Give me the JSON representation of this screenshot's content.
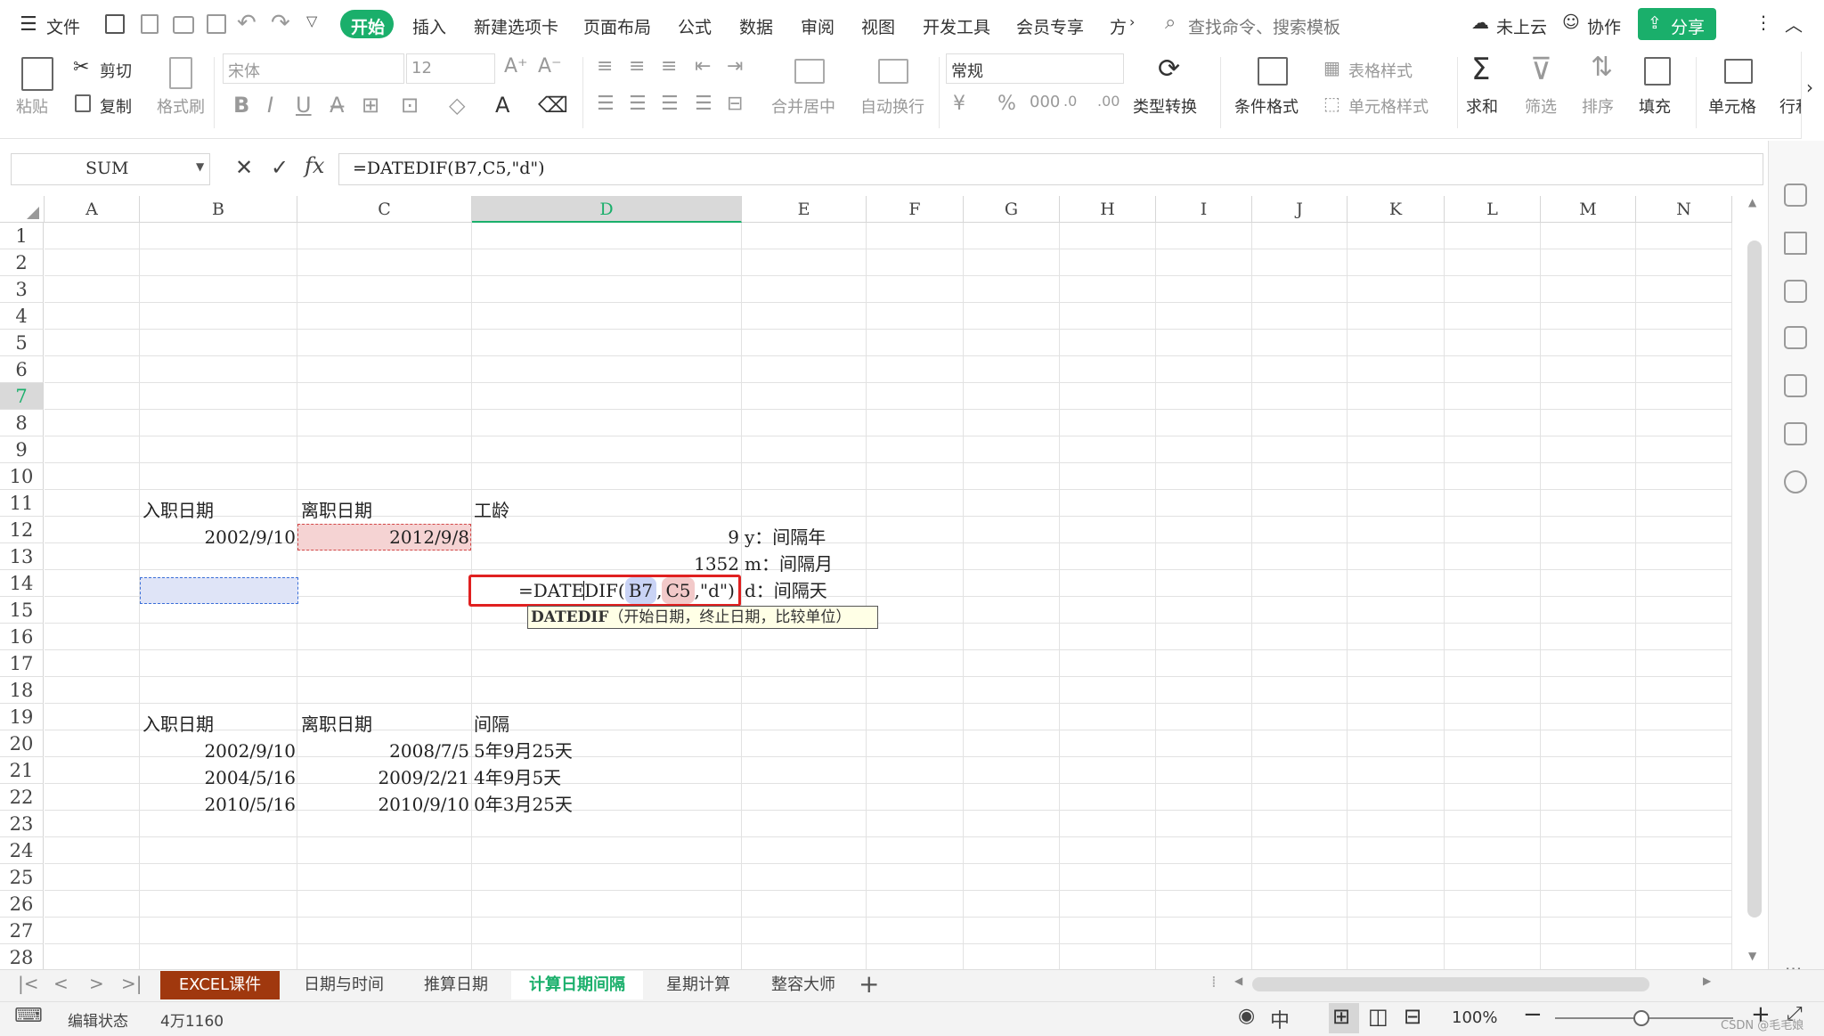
{
  "menubar": {
    "file_label": "文件",
    "tabs": [
      "开始",
      "插入",
      "新建选项卡",
      "页面布局",
      "公式",
      "数据",
      "审阅",
      "视图",
      "开发工具",
      "会员专享",
      "方"
    ],
    "active_tab": "开始",
    "search_placeholder": "查找命令、搜索模板",
    "cloud_label": "未上云",
    "collab_label": "协作",
    "share_label": "分享"
  },
  "ribbon": {
    "paste": "粘贴",
    "cut": "剪切",
    "copy": "复制",
    "format_painter": "格式刷",
    "font_name": "宋体",
    "font_size": "12",
    "number_format": "常规",
    "merge_center": "合并居中",
    "wrap_text": "自动换行",
    "type_convert": "类型转换",
    "cond_format": "条件格式",
    "table_style": "表格样式",
    "cell_style": "单元格样式",
    "sum": "求和",
    "filter": "筛选",
    "sort": "排序",
    "fill": "填充",
    "cell": "单元格",
    "row_col": "行和"
  },
  "formula_bar": {
    "name_box": "SUM",
    "fx": "fx",
    "formula": "=DATEDIF(B7,C5,\"d\")"
  },
  "sheet": {
    "columns": [
      "A",
      "B",
      "C",
      "D",
      "E",
      "F",
      "G",
      "H",
      "I",
      "J",
      "K",
      "L",
      "M",
      "N"
    ],
    "rows": [
      "1",
      "2",
      "3",
      "4",
      "5",
      "6",
      "7",
      "8",
      "9",
      "10",
      "11",
      "12",
      "13",
      "14",
      "15",
      "16",
      "17",
      "18",
      "19",
      "20",
      "21",
      "22",
      "23",
      "24",
      "25",
      "26",
      "27",
      "28"
    ],
    "cells": {
      "B4": "入职日期",
      "C4": "离职日期",
      "D4": "工龄",
      "B5": "2002/9/10",
      "C5": "2012/9/8",
      "D5": "9",
      "D6": "1352",
      "E5": "y：间隔年",
      "E6": "m：间隔月",
      "E7": "d：间隔天",
      "D7_prefix": "=DATEDIF(",
      "D7_ref1": "B7",
      "D7_comma1": ",",
      "D7_ref2": "C5",
      "D7_suffix": ",\"d\")",
      "B12": "入职日期",
      "C12": "离职日期",
      "D12": "间隔",
      "B13": "2002/9/10",
      "C13": "2008/7/5",
      "D13": "5年9月25天",
      "B14": "2004/5/16",
      "C14": "2009/2/21",
      "D14": "4年9月5天",
      "B15": "2010/5/16",
      "C15": "2010/9/10",
      "D15": "0年3月25天"
    },
    "tooltip_func": "DATEDIF",
    "tooltip_args": "（开始日期，终止日期，比较单位）"
  },
  "sheet_tabs": [
    "EXCEL课件",
    "日期与时间",
    "推算日期",
    "计算日期间隔",
    "星期计算",
    "整容大师"
  ],
  "active_sheet": "计算日期间隔",
  "status": {
    "mode": "编辑状态",
    "count": "4万1160",
    "zoom": "100%",
    "watermark": "CSDN @毛毛娘"
  },
  "colors": {
    "accent_green": "#1aaf6b",
    "tab_brown": "#a0380e",
    "ref_blue_bg": "#c9d3f5",
    "ref_red_bg": "#f2c9c9",
    "highlight_red": "#e02020"
  }
}
